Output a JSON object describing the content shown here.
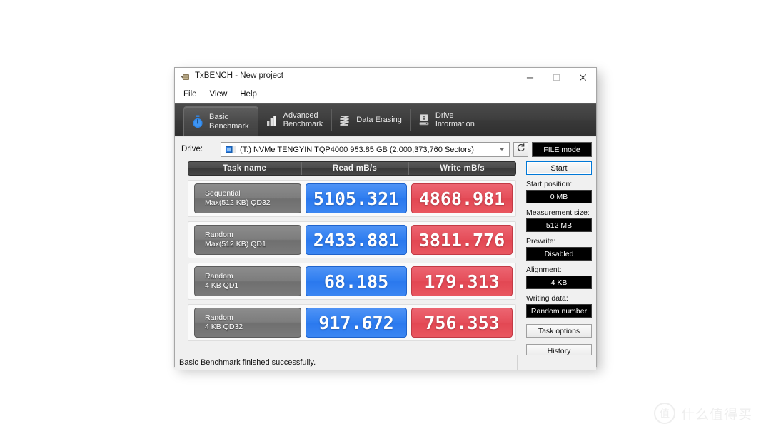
{
  "window": {
    "title": "TxBENCH - New project",
    "app_icon": "app-icon",
    "controls": {
      "minimize": "─",
      "maximize": "□",
      "close": "✕"
    }
  },
  "menu": {
    "items": [
      {
        "label": "File"
      },
      {
        "label": "View"
      },
      {
        "label": "Help"
      }
    ]
  },
  "tabs": [
    {
      "line1": "Basic",
      "line2": "Benchmark",
      "icon": "stopwatch-icon",
      "active": true
    },
    {
      "line1": "Advanced",
      "line2": "Benchmark",
      "icon": "bar-chart-icon",
      "active": false
    },
    {
      "line1": "Data Erasing",
      "line2": "",
      "icon": "eraser-wave-icon",
      "active": false
    },
    {
      "line1": "Drive",
      "line2": "Information",
      "icon": "drive-info-icon",
      "active": false
    }
  ],
  "drive": {
    "label": "Drive:",
    "selected": "(T:) NVMe TENGYIN TQP4000  953.85 GB (2,000,373,760 Sectors)",
    "refresh_icon": "refresh-icon",
    "file_mode_label": "FILE mode"
  },
  "table": {
    "headers": {
      "task": "Task name",
      "read": "Read mB/s",
      "write": "Write mB/s"
    },
    "rows": [
      {
        "name_line1": "Sequential",
        "name_line2": "Max(512 KB) QD32",
        "read": "5105.321",
        "write": "4868.981"
      },
      {
        "name_line1": "Random",
        "name_line2": "Max(512 KB) QD1",
        "read": "2433.881",
        "write": "3811.776"
      },
      {
        "name_line1": "Random",
        "name_line2": "4 KB QD1",
        "read": "68.185",
        "write": "179.313"
      },
      {
        "name_line1": "Random",
        "name_line2": "4 KB QD32",
        "read": "917.672",
        "write": "756.353"
      }
    ]
  },
  "settings": {
    "start_button": "Start",
    "start_position_label": "Start position:",
    "start_position_value": "0 MB",
    "measurement_size_label": "Measurement size:",
    "measurement_size_value": "512 MB",
    "prewrite_label": "Prewrite:",
    "prewrite_value": "Disabled",
    "alignment_label": "Alignment:",
    "alignment_value": "4 KB",
    "writing_data_label": "Writing data:",
    "writing_data_value": "Random number",
    "task_options_button": "Task options",
    "history_button": "History"
  },
  "status": {
    "message": "Basic Benchmark finished successfully."
  },
  "watermark": {
    "logo_char": "值",
    "text": "什么值得买"
  },
  "colors": {
    "read_accent": "#2e7df0",
    "write_accent": "#e54d59",
    "tab_strip": "#3e3e3e",
    "value_box_text": "#ffffff",
    "start_focus": "#0078d7"
  },
  "chart_data": {
    "type": "bar",
    "title": "TxBENCH Basic Benchmark Results",
    "categories": [
      "Sequential Max(512 KB) QD32",
      "Random Max(512 KB) QD1",
      "Random 4 KB QD1",
      "Random 4 KB QD32"
    ],
    "series": [
      {
        "name": "Read mB/s",
        "values": [
          5105.321,
          2433.881,
          68.185,
          917.672
        ]
      },
      {
        "name": "Write mB/s",
        "values": [
          4868.981,
          3811.776,
          179.313,
          756.353
        ]
      }
    ],
    "xlabel": "Task name",
    "ylabel": "mB/s",
    "legend": "inline",
    "grid": false
  }
}
